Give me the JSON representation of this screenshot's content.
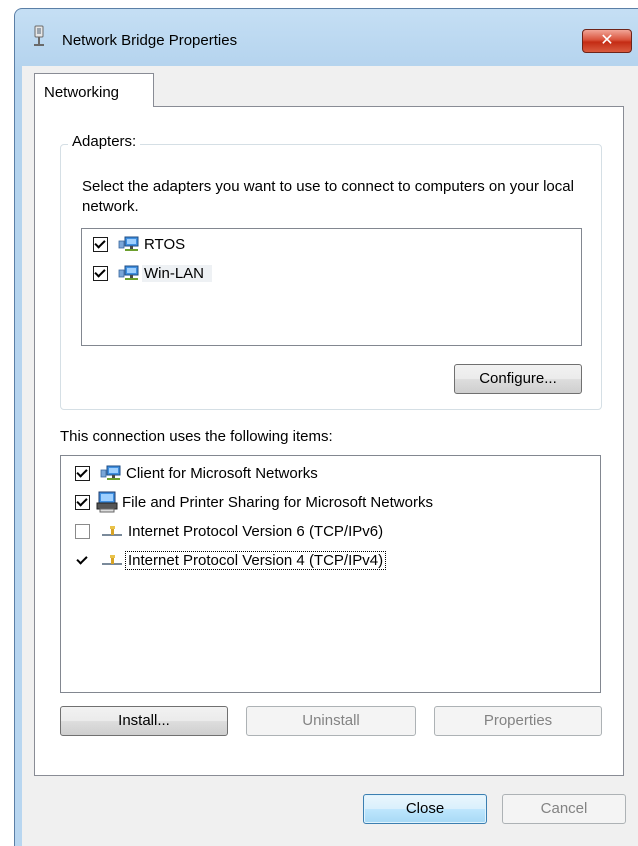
{
  "window": {
    "title": "Network Bridge Properties",
    "close_glyph": "✕"
  },
  "tabs": [
    {
      "label": "Networking",
      "active": true
    }
  ],
  "adapters": {
    "group_label": "Adapters:",
    "description": "Select the adapters you want to use to connect to computers on your local network.",
    "items": [
      {
        "label": "RTOS",
        "checked": true,
        "icon": "network-adapter-icon"
      },
      {
        "label": "Win-LAN",
        "checked": true,
        "icon": "network-adapter-icon",
        "selected": true
      }
    ],
    "configure_label": "Configure..."
  },
  "connection_items": {
    "caption": "This connection uses the following items:",
    "items": [
      {
        "label": "Client for Microsoft Networks",
        "checked": true,
        "icon": "network-client-icon"
      },
      {
        "label": "File and Printer Sharing for Microsoft Networks",
        "checked": true,
        "icon": "file-printer-sharing-icon"
      },
      {
        "label": "Internet Protocol Version 6 (TCP/IPv6)",
        "checked": false,
        "icon": "protocol-icon"
      },
      {
        "label": "Internet Protocol Version 4 (TCP/IPv4)",
        "checked": true,
        "icon": "protocol-icon",
        "focused": true
      }
    ],
    "install_label": "Install...",
    "uninstall_label": "Uninstall",
    "properties_label": "Properties"
  },
  "footer": {
    "close_label": "Close",
    "cancel_label": "Cancel"
  },
  "colors": {
    "titlebar": "#b8d6f0",
    "close_button": "#c42b14",
    "dialog_background": "#f0f0f0",
    "default_button_border": "#3c7fb1"
  }
}
